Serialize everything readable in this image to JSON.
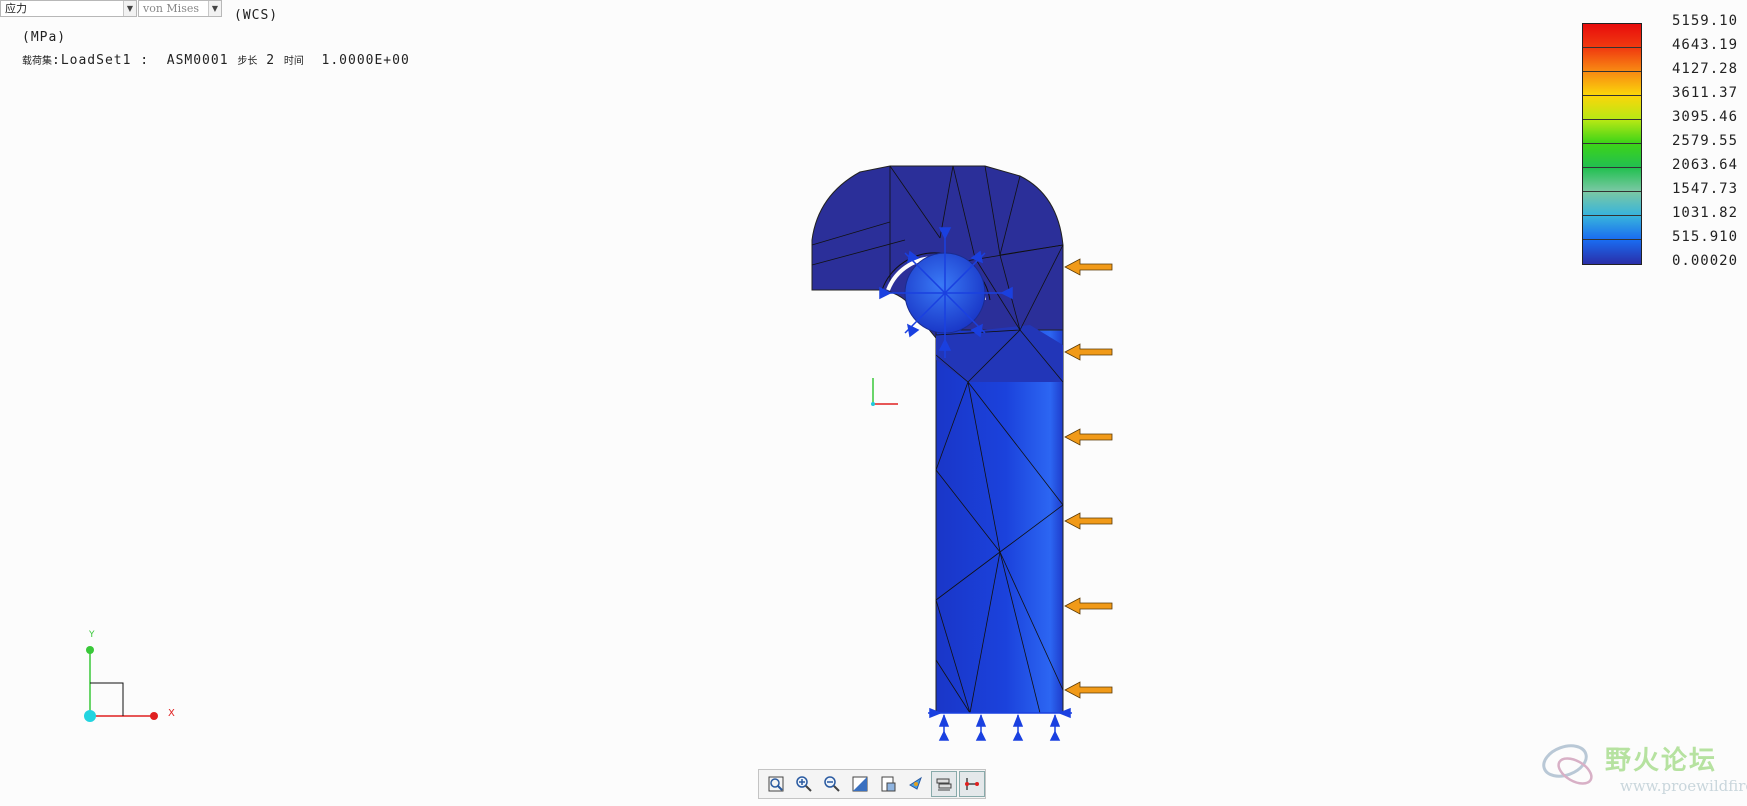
{
  "toolbar_top": {
    "result_type": "应力",
    "component": "von Mises",
    "coordinate_system": "(WCS)"
  },
  "header": {
    "units": "(MPa)",
    "loadset_label": "载荷集",
    "loadset_value": ":LoadSet1 :",
    "analysis": "ASM0001",
    "step_label": "步长",
    "step_value": "2",
    "time_label": "时间",
    "time_value": "1.0000E+00"
  },
  "legend": {
    "values": [
      "5159.10",
      "4643.19",
      "4127.28",
      "3611.37",
      "3095.46",
      "2579.55",
      "2063.64",
      "1547.73",
      "1031.82",
      "515.910",
      "0.00020"
    ],
    "colors": [
      "#e80c0c",
      "#f03a10",
      "#f88a12",
      "#fad60a",
      "#b8e814",
      "#3dd418",
      "#22c050",
      "#7ac8a4",
      "#38b4dc",
      "#1a6cf0",
      "#2a2ea8"
    ]
  },
  "triad": {
    "x_label": "X",
    "y_label": "Y"
  },
  "bottom_toolbar": {
    "buttons": [
      {
        "name": "zoom-fit-icon",
        "label": "重新调整"
      },
      {
        "name": "zoom-in-icon",
        "label": "放大"
      },
      {
        "name": "zoom-out-icon",
        "label": "缩小"
      },
      {
        "name": "shading-icon",
        "label": "着色"
      },
      {
        "name": "saved-views-icon",
        "label": "已保存视图"
      },
      {
        "name": "spin-center-icon",
        "label": "旋转中心"
      },
      {
        "name": "layers-icon",
        "label": "图层"
      },
      {
        "name": "datum-display-icon",
        "label": "基准显示"
      }
    ]
  },
  "watermark": {
    "name": "野火论坛",
    "url": "www.proewildfire.cn"
  },
  "colors": {
    "model_dark": "#2b2f99",
    "model_mid": "#1b3fd8",
    "model_light": "#2f63f0",
    "load_arrow": "#f19a18",
    "constraint": "#1a40e0",
    "background": "#fcfcfc"
  }
}
